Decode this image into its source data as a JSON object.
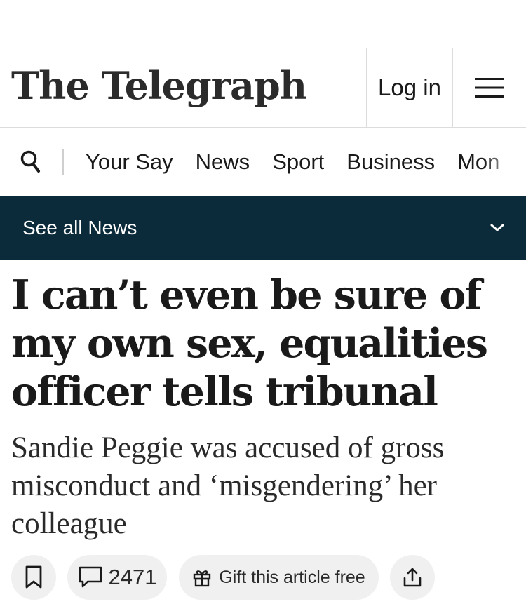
{
  "masthead": {
    "logo_text": "The Telegraph",
    "login_label": "Log in",
    "menu_icon": "hamburger-menu-icon"
  },
  "nav": {
    "search_icon": "search-icon",
    "items": [
      "Your Say",
      "News",
      "Sport",
      "Business",
      "Mon"
    ]
  },
  "section_bar": {
    "label": "See all News",
    "icon": "chevron-down-icon",
    "background": "#0b2a3a"
  },
  "article": {
    "headline": "I can’t even be sure of my own sex, equalities officer tells tribunal",
    "standfirst": "Sandie Peggie was accused of gross misconduct and ‘misgendering’ her colleague"
  },
  "actions": {
    "bookmark_icon": "bookmark-icon",
    "comments_icon": "comment-icon",
    "comments_count": "2471",
    "gift_icon": "gift-icon",
    "gift_label": "Gift this article free",
    "share_icon": "share-icon"
  }
}
